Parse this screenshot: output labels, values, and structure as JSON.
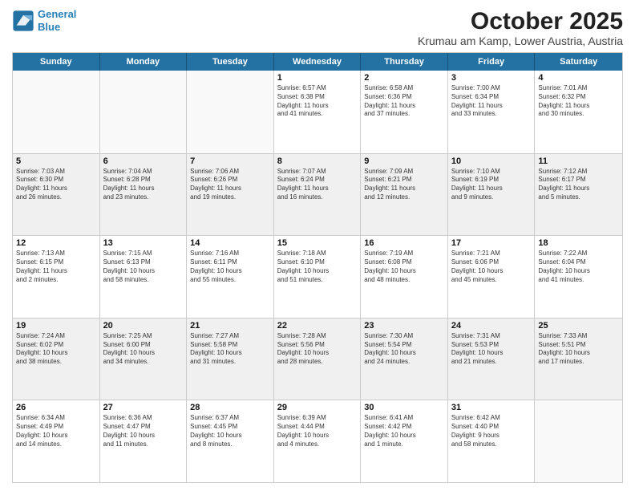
{
  "header": {
    "logo_line1": "General",
    "logo_line2": "Blue",
    "month": "October 2025",
    "location": "Krumau am Kamp, Lower Austria, Austria"
  },
  "weekdays": [
    "Sunday",
    "Monday",
    "Tuesday",
    "Wednesday",
    "Thursday",
    "Friday",
    "Saturday"
  ],
  "weeks": [
    [
      {
        "day": "",
        "info": ""
      },
      {
        "day": "",
        "info": ""
      },
      {
        "day": "",
        "info": ""
      },
      {
        "day": "1",
        "info": "Sunrise: 6:57 AM\nSunset: 6:38 PM\nDaylight: 11 hours\nand 41 minutes."
      },
      {
        "day": "2",
        "info": "Sunrise: 6:58 AM\nSunset: 6:36 PM\nDaylight: 11 hours\nand 37 minutes."
      },
      {
        "day": "3",
        "info": "Sunrise: 7:00 AM\nSunset: 6:34 PM\nDaylight: 11 hours\nand 33 minutes."
      },
      {
        "day": "4",
        "info": "Sunrise: 7:01 AM\nSunset: 6:32 PM\nDaylight: 11 hours\nand 30 minutes."
      }
    ],
    [
      {
        "day": "5",
        "info": "Sunrise: 7:03 AM\nSunset: 6:30 PM\nDaylight: 11 hours\nand 26 minutes."
      },
      {
        "day": "6",
        "info": "Sunrise: 7:04 AM\nSunset: 6:28 PM\nDaylight: 11 hours\nand 23 minutes."
      },
      {
        "day": "7",
        "info": "Sunrise: 7:06 AM\nSunset: 6:26 PM\nDaylight: 11 hours\nand 19 minutes."
      },
      {
        "day": "8",
        "info": "Sunrise: 7:07 AM\nSunset: 6:24 PM\nDaylight: 11 hours\nand 16 minutes."
      },
      {
        "day": "9",
        "info": "Sunrise: 7:09 AM\nSunset: 6:21 PM\nDaylight: 11 hours\nand 12 minutes."
      },
      {
        "day": "10",
        "info": "Sunrise: 7:10 AM\nSunset: 6:19 PM\nDaylight: 11 hours\nand 9 minutes."
      },
      {
        "day": "11",
        "info": "Sunrise: 7:12 AM\nSunset: 6:17 PM\nDaylight: 11 hours\nand 5 minutes."
      }
    ],
    [
      {
        "day": "12",
        "info": "Sunrise: 7:13 AM\nSunset: 6:15 PM\nDaylight: 11 hours\nand 2 minutes."
      },
      {
        "day": "13",
        "info": "Sunrise: 7:15 AM\nSunset: 6:13 PM\nDaylight: 10 hours\nand 58 minutes."
      },
      {
        "day": "14",
        "info": "Sunrise: 7:16 AM\nSunset: 6:11 PM\nDaylight: 10 hours\nand 55 minutes."
      },
      {
        "day": "15",
        "info": "Sunrise: 7:18 AM\nSunset: 6:10 PM\nDaylight: 10 hours\nand 51 minutes."
      },
      {
        "day": "16",
        "info": "Sunrise: 7:19 AM\nSunset: 6:08 PM\nDaylight: 10 hours\nand 48 minutes."
      },
      {
        "day": "17",
        "info": "Sunrise: 7:21 AM\nSunset: 6:06 PM\nDaylight: 10 hours\nand 45 minutes."
      },
      {
        "day": "18",
        "info": "Sunrise: 7:22 AM\nSunset: 6:04 PM\nDaylight: 10 hours\nand 41 minutes."
      }
    ],
    [
      {
        "day": "19",
        "info": "Sunrise: 7:24 AM\nSunset: 6:02 PM\nDaylight: 10 hours\nand 38 minutes."
      },
      {
        "day": "20",
        "info": "Sunrise: 7:25 AM\nSunset: 6:00 PM\nDaylight: 10 hours\nand 34 minutes."
      },
      {
        "day": "21",
        "info": "Sunrise: 7:27 AM\nSunset: 5:58 PM\nDaylight: 10 hours\nand 31 minutes."
      },
      {
        "day": "22",
        "info": "Sunrise: 7:28 AM\nSunset: 5:56 PM\nDaylight: 10 hours\nand 28 minutes."
      },
      {
        "day": "23",
        "info": "Sunrise: 7:30 AM\nSunset: 5:54 PM\nDaylight: 10 hours\nand 24 minutes."
      },
      {
        "day": "24",
        "info": "Sunrise: 7:31 AM\nSunset: 5:53 PM\nDaylight: 10 hours\nand 21 minutes."
      },
      {
        "day": "25",
        "info": "Sunrise: 7:33 AM\nSunset: 5:51 PM\nDaylight: 10 hours\nand 17 minutes."
      }
    ],
    [
      {
        "day": "26",
        "info": "Sunrise: 6:34 AM\nSunset: 4:49 PM\nDaylight: 10 hours\nand 14 minutes."
      },
      {
        "day": "27",
        "info": "Sunrise: 6:36 AM\nSunset: 4:47 PM\nDaylight: 10 hours\nand 11 minutes."
      },
      {
        "day": "28",
        "info": "Sunrise: 6:37 AM\nSunset: 4:45 PM\nDaylight: 10 hours\nand 8 minutes."
      },
      {
        "day": "29",
        "info": "Sunrise: 6:39 AM\nSunset: 4:44 PM\nDaylight: 10 hours\nand 4 minutes."
      },
      {
        "day": "30",
        "info": "Sunrise: 6:41 AM\nSunset: 4:42 PM\nDaylight: 10 hours\nand 1 minute."
      },
      {
        "day": "31",
        "info": "Sunrise: 6:42 AM\nSunset: 4:40 PM\nDaylight: 9 hours\nand 58 minutes."
      },
      {
        "day": "",
        "info": ""
      }
    ]
  ]
}
